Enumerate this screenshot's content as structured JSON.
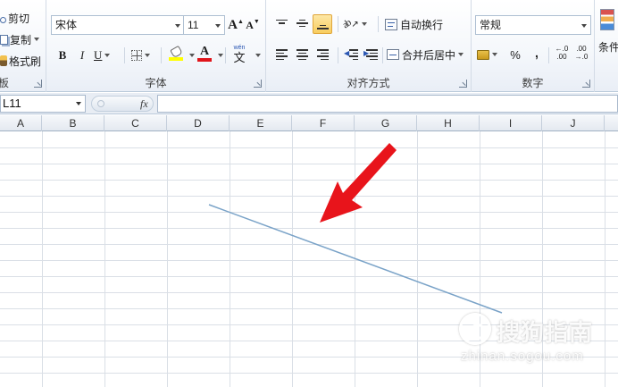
{
  "ribbon": {
    "clipboard": {
      "cut_label": "剪切",
      "copy_label": "复制",
      "format_painter_label": "格式刷",
      "group_label_fragment": "板"
    },
    "font": {
      "font_name": "宋体",
      "font_size": "11",
      "grow_font": "A",
      "shrink_font": "A",
      "bold": "B",
      "italic": "I",
      "underline": "U",
      "font_color_glyph": "A",
      "phonetic_glyph": "文",
      "phonetic_small": "wén",
      "group_label": "字体"
    },
    "alignment": {
      "wrap_text_label": "自动换行",
      "merge_center_label": "合并后居中",
      "group_label": "对齐方式"
    },
    "number": {
      "format_value": "常规",
      "percent": "%",
      "comma": ",",
      "increase_decimal_top": "←.0",
      "increase_decimal_bottom": ".00",
      "decrease_decimal_top": ".00",
      "decrease_decimal_bottom": "→.0",
      "group_label": "数字"
    },
    "styles": {
      "conditional_label_fragment": "条件"
    }
  },
  "formula_bar": {
    "name_box_value": "L11",
    "fx_label": "fx",
    "formula_value": ""
  },
  "sheet": {
    "columns": [
      "A",
      "B",
      "C",
      "D",
      "E",
      "F",
      "G",
      "H",
      "I",
      "J"
    ]
  },
  "annotation": {
    "arrow_color": "#e8141b",
    "line_color": "#7aa3c8"
  },
  "watermark": {
    "brand": "搜狗指南",
    "url": "zhinan.sogou.com"
  },
  "colors": {
    "ribbon_bg": "#f4f7fb",
    "header_bg": "#e4e9f0",
    "grid_line": "#dadfe6",
    "active_highlight": "#f8cd5f"
  }
}
